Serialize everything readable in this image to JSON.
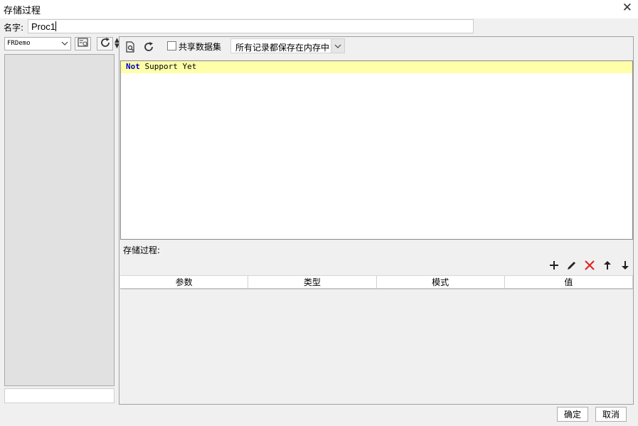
{
  "window": {
    "title": "存储过程",
    "close_glyph": "✕"
  },
  "name_field": {
    "label": "名字:",
    "value": "Proc1"
  },
  "left": {
    "database": "FRDemo",
    "icons": [
      "chevron-down-icon",
      "edit-data-connection-icon",
      "refresh-icon"
    ],
    "search_value": ""
  },
  "toolbar": {
    "share_dataset_label": "共享数据集",
    "share_dataset_checked": false,
    "storage_mode": "所有记录都保存在内存中",
    "icons": [
      "preview-icon",
      "refresh-icon"
    ]
  },
  "editor": {
    "keyword": "Not",
    "rest": " Support Yet"
  },
  "procedure": {
    "label": "存储过程:",
    "actions": [
      "add-icon",
      "edit-icon",
      "delete-icon",
      "move-up-icon",
      "move-down-icon"
    ],
    "columns": [
      "参数",
      "类型",
      "模式",
      "值"
    ],
    "rows": []
  },
  "footer": {
    "ok_label": "确定",
    "cancel_label": "取消"
  }
}
